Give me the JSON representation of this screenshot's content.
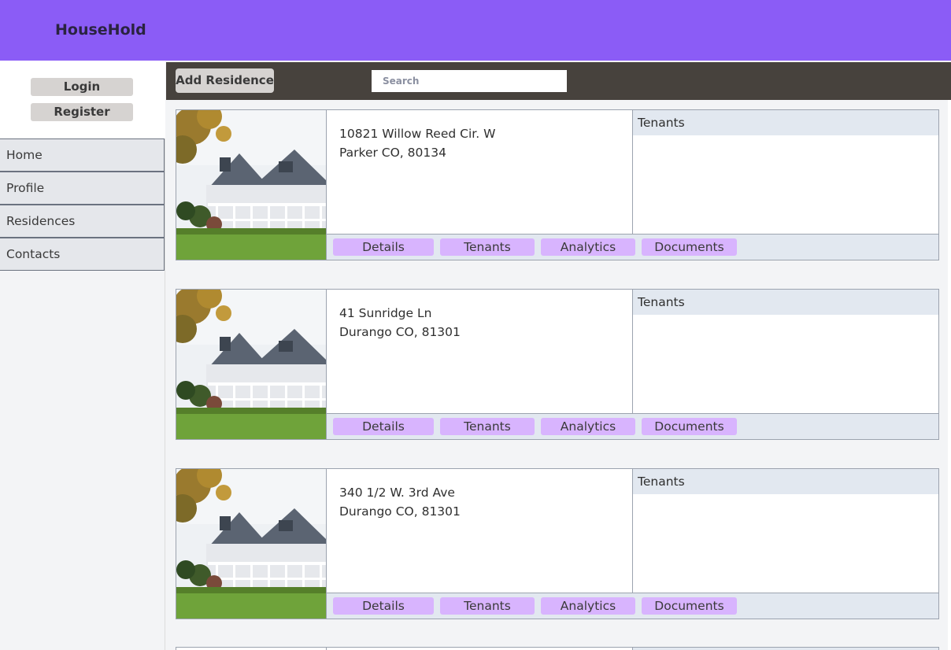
{
  "app": {
    "title": "HouseHold"
  },
  "auth": {
    "login_label": "Login",
    "register_label": "Register"
  },
  "nav": {
    "items": [
      {
        "label": "Home"
      },
      {
        "label": "Profile"
      },
      {
        "label": "Residences"
      },
      {
        "label": "Contacts"
      }
    ]
  },
  "toolbar": {
    "add_label": "Add Residence",
    "search_placeholder": "Search"
  },
  "residences": [
    {
      "line1": "10821 Willow Reed Cir. W",
      "line2": "Parker CO, 80134",
      "tenants_title": "Tenants"
    },
    {
      "line1": "41 Sunridge Ln",
      "line2": "Durango CO, 81301",
      "tenants_title": "Tenants"
    },
    {
      "line1": "340 1/2 W. 3rd Ave",
      "line2": "Durango CO, 81301",
      "tenants_title": "Tenants"
    }
  ],
  "actions": {
    "details": "Details",
    "tenants": "Tenants",
    "analytics": "Analytics",
    "documents": "Documents"
  },
  "colors": {
    "header": "#8b5cf6",
    "toolbar": "#47423d",
    "action_button": "#d8b4fe",
    "panel": "#e2e8f0"
  },
  "icons": {
    "residence_image": "house-photo"
  }
}
